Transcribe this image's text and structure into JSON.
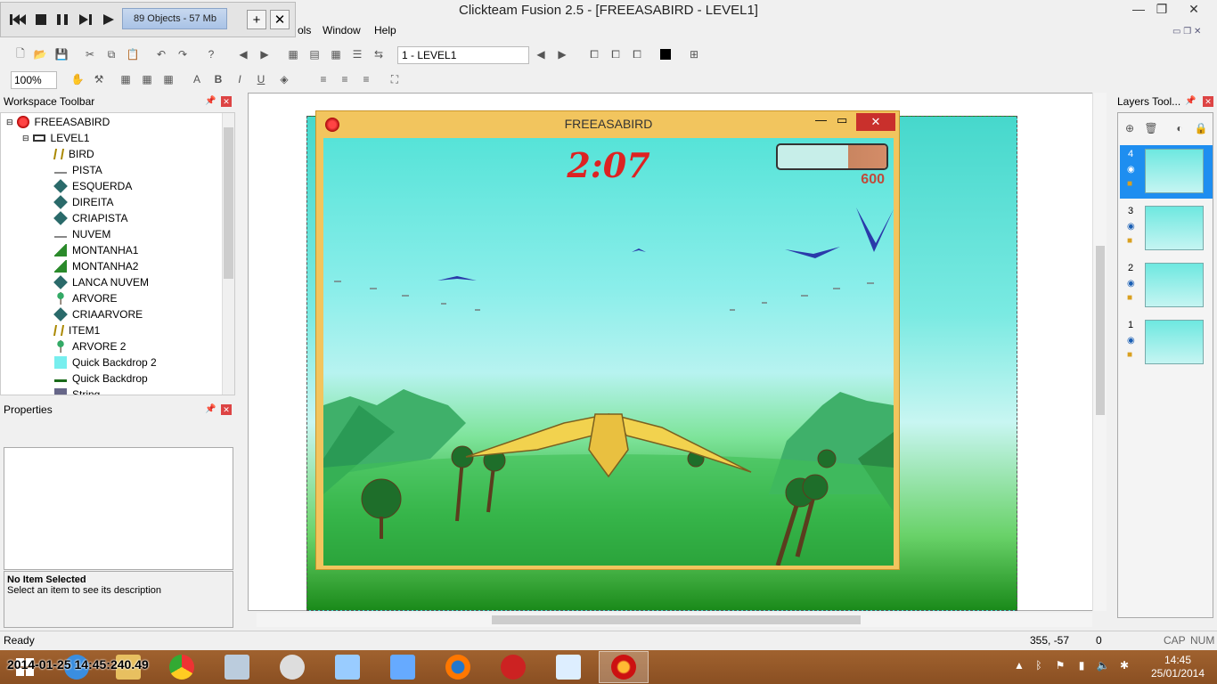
{
  "window": {
    "title": "Clickteam Fusion 2.5 - [FREEASABIRD - LEVEL1]"
  },
  "runtime_bar": {
    "objects": "89 Objects - 57 Mb"
  },
  "menu": [
    "ols",
    "Window",
    "Help"
  ],
  "toolbar": {
    "frame": "1 - LEVEL1",
    "zoom": "100%"
  },
  "workspace": {
    "title": "Workspace Toolbar",
    "app": "FREEASABIRD",
    "frame": "LEVEL1",
    "items": [
      {
        "label": "BIRD",
        "icon": "bird-icon"
      },
      {
        "label": "PISTA",
        "icon": "line-icon"
      },
      {
        "label": "ESQUERDA",
        "icon": "active-icon"
      },
      {
        "label": "DIREITA",
        "icon": "active-icon"
      },
      {
        "label": "CRIAPISTA",
        "icon": "active-icon"
      },
      {
        "label": "NUVEM",
        "icon": "line-icon"
      },
      {
        "label": "MONTANHA1",
        "icon": "mountain-icon"
      },
      {
        "label": "MONTANHA2",
        "icon": "mountain-icon"
      },
      {
        "label": "LANCA NUVEM",
        "icon": "active-icon"
      },
      {
        "label": "ARVORE",
        "icon": "tree-icon"
      },
      {
        "label": "CRIAARVORE",
        "icon": "active-icon"
      },
      {
        "label": "ITEM1",
        "icon": "bird-icon"
      },
      {
        "label": "ARVORE 2",
        "icon": "tree-icon"
      },
      {
        "label": "Quick Backdrop 2",
        "icon": "backdrop-icon"
      },
      {
        "label": "Quick Backdrop",
        "icon": "backdrop-dark-icon"
      },
      {
        "label": "String",
        "icon": "string-icon"
      }
    ]
  },
  "properties": {
    "title": "Properties",
    "no_item": "No Item Selected",
    "hint": "Select an item to see its description"
  },
  "game": {
    "title": "FREEASABIRD",
    "timer": "2:07",
    "score": "600",
    "energy_fraction": 0.35
  },
  "layers": {
    "title": "Layers Tool...",
    "items": [
      "4",
      "3",
      "2",
      "1"
    ]
  },
  "status": {
    "ready": "Ready",
    "coords": "355, -57",
    "count": "0",
    "cap": "CAP",
    "num": "NUM"
  },
  "overlay_timestamp": "2014-01-25 14:45:240.49",
  "clock": {
    "time": "14:45",
    "date": "25/01/2014"
  }
}
